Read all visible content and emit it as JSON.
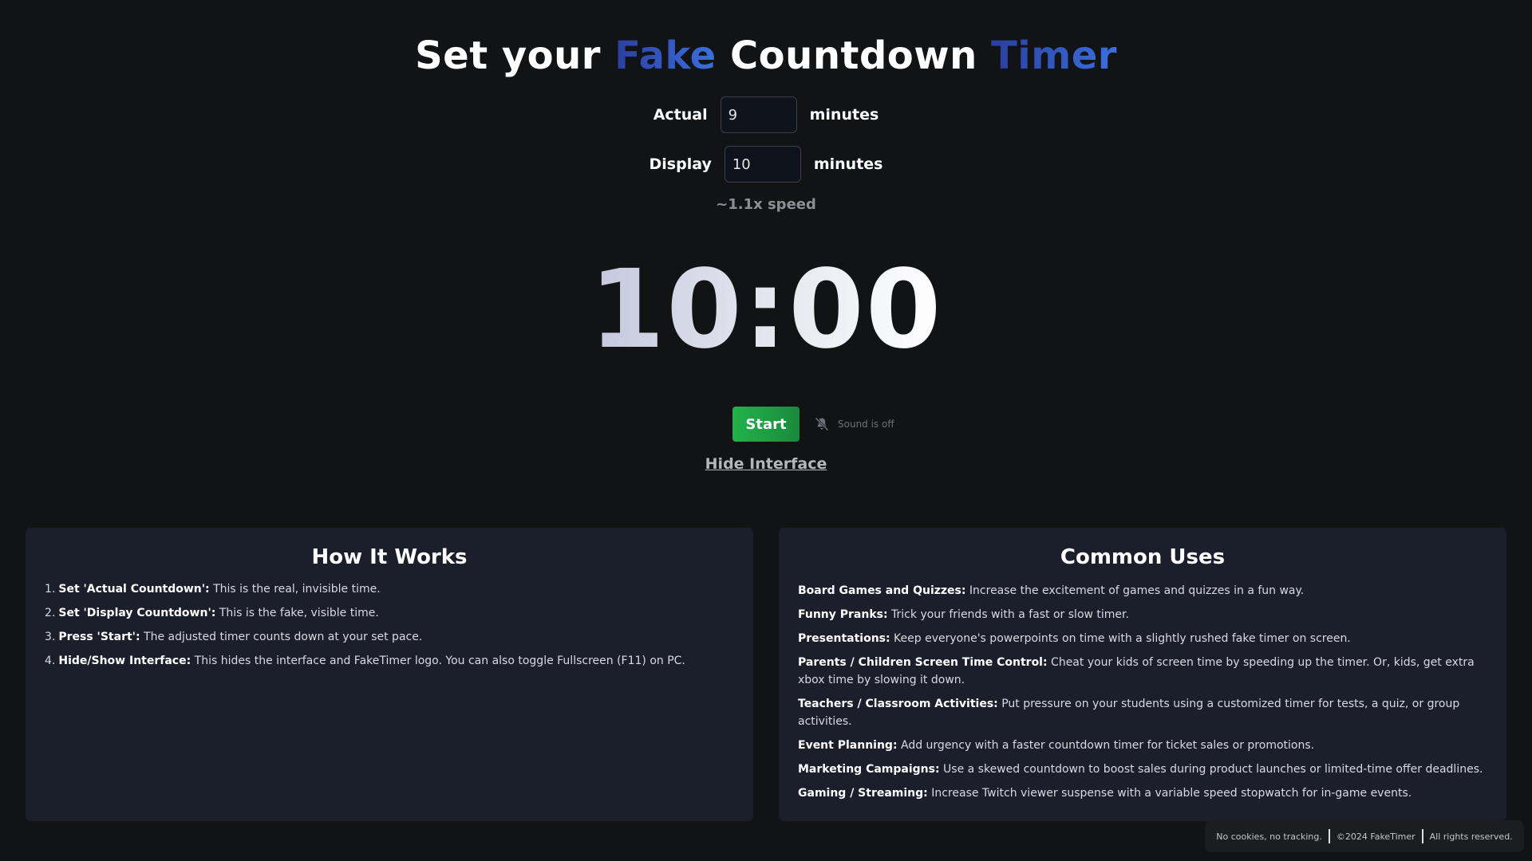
{
  "header": {
    "title_parts": [
      "Set your ",
      "Fake",
      " Countdown ",
      "Timer"
    ],
    "accent_colors": [
      "#2a3fa0",
      "#3b6fe0"
    ]
  },
  "settings": {
    "actual": {
      "label": "Actual",
      "value": "9",
      "unit": "minutes"
    },
    "display": {
      "label": "Display",
      "value": "10",
      "unit": "minutes"
    },
    "speed_text": "~1.1x speed"
  },
  "timer": {
    "display": "10:00"
  },
  "controls": {
    "start_label": "Start",
    "start_color": "#22b24c",
    "sound_icon": "bell-slash-icon",
    "sound_text": "Sound is off",
    "hide_interface_label": "Hide Interface"
  },
  "how_it_works": {
    "title": "How It Works",
    "steps": [
      {
        "num": "1.",
        "bold": "Set 'Actual Countdown':",
        "text": " This is the real, invisible time."
      },
      {
        "num": "2.",
        "bold": "Set 'Display Countdown':",
        "text": " This is the fake, visible time."
      },
      {
        "num": "3.",
        "bold": "Press 'Start':",
        "text": " The adjusted timer counts down at your set pace."
      },
      {
        "num": "4.",
        "bold": "Hide/Show Interface:",
        "text": " This hides the interface and FakeTimer logo. You can also toggle Fullscreen (F11) on PC."
      }
    ]
  },
  "common_uses": {
    "title": "Common Uses",
    "items": [
      {
        "bold": "Board Games and Quizzes:",
        "text": " Increase the excitement of games and quizzes in a fun way."
      },
      {
        "bold": "Funny Pranks:",
        "text": " Trick your friends with a fast or slow timer."
      },
      {
        "bold": "Presentations:",
        "text": " Keep everyone's powerpoints on time with a slightly rushed fake timer on screen."
      },
      {
        "bold": "Parents / Children Screen Time Control:",
        "text": " Cheat your kids of screen time by speeding up the timer. Or, kids, get extra xbox time by slowing it down."
      },
      {
        "bold": "Teachers / Classroom Activities:",
        "text": " Put pressure on your students using a customized timer for tests, a quiz, or group activities."
      },
      {
        "bold": "Event Planning:",
        "text": " Add urgency with a faster countdown timer for ticket sales or promotions."
      },
      {
        "bold": "Marketing Campaigns:",
        "text": " Use a skewed countdown to boost sales during product launches or limited-time offer deadlines."
      },
      {
        "bold": "Gaming / Streaming:",
        "text": " Increase Twitch viewer suspense with a variable speed stopwatch for in-game events."
      }
    ]
  },
  "footer": {
    "items": [
      "No cookies, no tracking.",
      "©2024 FakeTimer",
      "All rights reserved."
    ]
  }
}
